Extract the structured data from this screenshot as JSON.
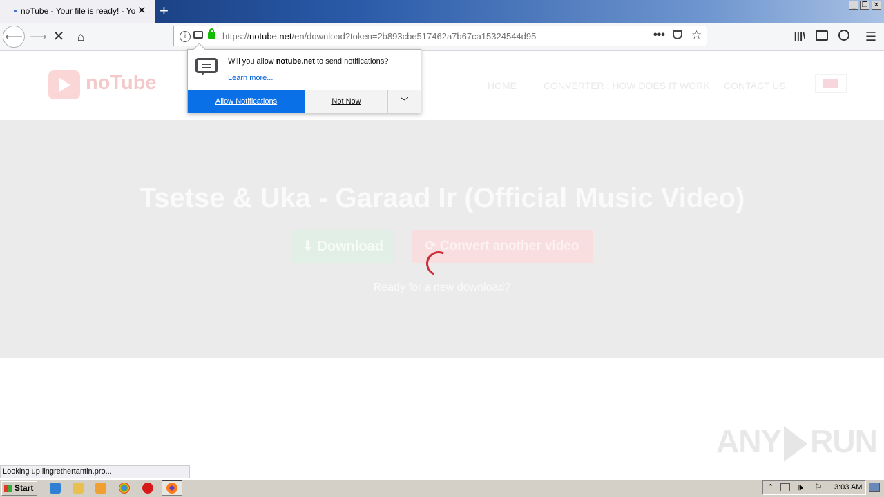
{
  "browser": {
    "tab_title": "noTube - Your file is ready! - YouT",
    "new_tab_symbol": "+",
    "url_prefix": "https://",
    "url_host": "notube.net",
    "url_path": "/en/download?token=2b893cbe517462a7b67ca15324544d95",
    "window_controls": [
      "minimize-icon",
      "restore-icon",
      "close-icon"
    ],
    "status_text": "Looking up lingrethertantin.pro..."
  },
  "notification_popup": {
    "question_prefix": "Will you allow ",
    "question_site": "notube.net",
    "question_suffix": " to send notifications?",
    "learn_more": "Learn more...",
    "allow_label": "Allow Notifications",
    "not_now_label": "Not Now"
  },
  "site": {
    "logo_text": "noTube",
    "nav": [
      "HOME",
      "CONVERTER : HOW DOES IT WORK",
      "CONTACT US"
    ],
    "song_title": "Tsetse & Uka - Garaad Ir (Official Music Video)",
    "download_label": "Download",
    "convert_label": "Convert another video",
    "ready_text": "Ready for a new download?"
  },
  "watermark": {
    "left": "ANY",
    "right": "RUN"
  },
  "taskbar": {
    "start_label": "Start",
    "clock": "3:03 AM",
    "apps": [
      "ie-icon",
      "explorer-icon",
      "media-player-icon",
      "chrome-icon",
      "opera-icon",
      "firefox-icon"
    ]
  },
  "colors": {
    "accent_blue": "#0a70e8",
    "spinner_red": "#cf2a37"
  }
}
